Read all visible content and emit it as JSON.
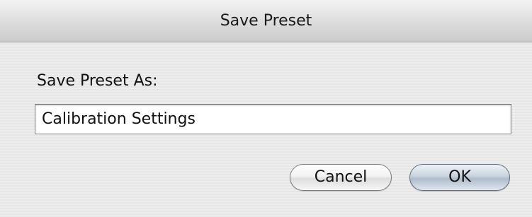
{
  "dialog": {
    "title": "Save Preset",
    "prompt_label": "Save Preset As:",
    "name_field": {
      "value": "Calibration Settings",
      "placeholder": ""
    },
    "buttons": {
      "cancel_label": "Cancel",
      "ok_label": "OK"
    }
  },
  "colors": {
    "default_button": "#c9d3de",
    "background": "#ececec"
  }
}
